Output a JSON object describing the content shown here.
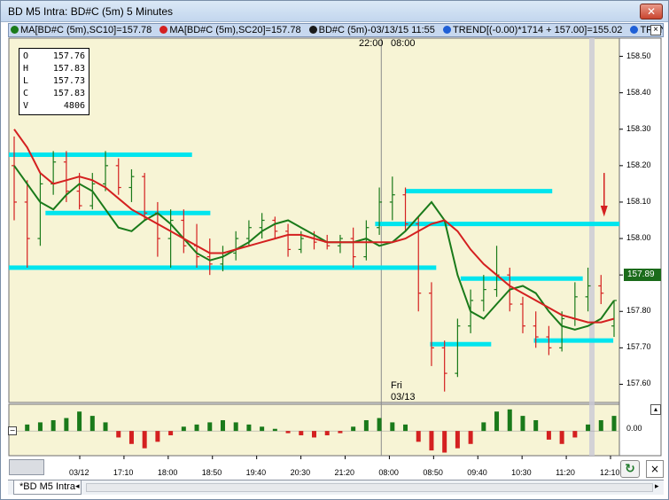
{
  "window": {
    "title": "BD M5 Intra: BD#C (5m) 5 Minutes",
    "close_glyph": "✕"
  },
  "legend": {
    "items": [
      {
        "label": "MA[BD#C (5m),SC10]=157.78",
        "color": "#1a7a1a"
      },
      {
        "label": "MA[BD#C (5m),SC20]=157.78",
        "color": "#d42020"
      },
      {
        "label": "BD#C (5m)-03/13/15 11:55",
        "color": "#1a1a1a"
      },
      {
        "label": "TREND[(-0.00)*1714 + 157.00]=155.02",
        "color": "#1f5fd6"
      },
      {
        "label": "TREN",
        "color": "#1f5fd6"
      }
    ],
    "close_glyph": "×"
  },
  "ohlc": {
    "rows": [
      {
        "k": "O",
        "v": "157.76"
      },
      {
        "k": "H",
        "v": "157.83"
      },
      {
        "k": "L",
        "v": "157.73"
      },
      {
        "k": "C",
        "v": "157.83"
      },
      {
        "k": "V",
        "v": "4806"
      }
    ]
  },
  "sessions": {
    "top_left": "22:00",
    "top_right": "08:00",
    "day_name": "Fri",
    "day_date": "03/13"
  },
  "price_axis": {
    "labels": [
      "158.50",
      "158.40",
      "158.30",
      "158.20",
      "158.10",
      "158.00",
      "157.90",
      "157.80",
      "157.70",
      "157.60"
    ],
    "current": "157.89"
  },
  "volume": {
    "zero_label": "0.00",
    "toggle_glyph": "−"
  },
  "time_axis": {
    "labels": [
      "03/12",
      "17:10",
      "18:00",
      "18:50",
      "19:40",
      "20:30",
      "21:20",
      "08:00",
      "08:50",
      "09:40",
      "10:30",
      "11:20",
      "12:10"
    ]
  },
  "controls": {
    "refresh_glyph": "↻",
    "collapse_glyph": "×",
    "collapse_top_glyph": "▴"
  },
  "tabs": [
    {
      "label": "*BD M5 Intra"
    }
  ],
  "colors": {
    "background": "#f7f4d5",
    "level_lines": "#00e5ee",
    "bar_up": "#1a7a1a",
    "bar_down": "#d42020",
    "ma_fast": "#1a7a1a",
    "ma_slow": "#d42020",
    "arrow": "#d42020"
  },
  "chart_data": {
    "type": "line",
    "ylim": [
      157.55,
      158.55
    ],
    "series": [
      {
        "name": "MA[BD#C (5m),SC10]",
        "values": [
          158.2,
          158.15,
          158.1,
          158.08,
          158.12,
          158.15,
          158.13,
          158.08,
          158.03,
          158.02,
          158.05,
          158.07,
          158.04,
          158.0,
          157.96,
          157.94,
          157.95,
          157.97,
          157.99,
          158.02,
          158.04,
          158.05,
          158.03,
          158.01,
          157.99,
          157.99,
          157.99,
          158.0,
          157.98,
          157.99,
          158.02,
          158.06,
          158.1,
          158.05,
          157.9,
          157.8,
          157.78,
          157.82,
          157.86,
          157.87,
          157.85,
          157.8,
          157.76,
          157.75,
          157.76,
          157.78,
          157.83
        ]
      },
      {
        "name": "MA[BD#C (5m),SC20]",
        "values": [
          158.3,
          158.25,
          158.18,
          158.15,
          158.16,
          158.17,
          158.16,
          158.14,
          158.11,
          158.08,
          158.06,
          158.04,
          158.02,
          158.0,
          157.98,
          157.96,
          157.96,
          157.97,
          157.98,
          157.99,
          158.0,
          158.01,
          158.01,
          158.0,
          157.99,
          157.99,
          157.99,
          157.99,
          157.99,
          157.99,
          158.0,
          158.02,
          158.04,
          158.05,
          158.02,
          157.97,
          157.93,
          157.9,
          157.87,
          157.85,
          157.83,
          157.81,
          157.79,
          157.78,
          157.77,
          157.77,
          157.78
        ]
      }
    ],
    "levels": [
      {
        "value": 158.23,
        "x_start": 0.0,
        "x_end": 0.3
      },
      {
        "value": 158.07,
        "x_start": 0.06,
        "x_end": 0.33
      },
      {
        "value": 157.92,
        "x_start": 0.0,
        "x_end": 0.7
      },
      {
        "value": 158.13,
        "x_start": 0.65,
        "x_end": 0.89
      },
      {
        "value": 158.04,
        "x_start": 0.6,
        "x_end": 1.0
      },
      {
        "value": 157.89,
        "x_start": 0.74,
        "x_end": 0.94
      },
      {
        "value": 157.72,
        "x_start": 0.86,
        "x_end": 0.99
      },
      {
        "value": 157.71,
        "x_start": 0.69,
        "x_end": 0.79
      }
    ],
    "price_bars": [
      {
        "o": 158.2,
        "h": 158.28,
        "l": 158.05,
        "c": 158.1
      },
      {
        "o": 158.1,
        "h": 158.16,
        "l": 157.92,
        "c": 158.0
      },
      {
        "o": 158.0,
        "h": 158.18,
        "l": 157.98,
        "c": 158.15
      },
      {
        "o": 158.15,
        "h": 158.24,
        "l": 158.12,
        "c": 158.21
      },
      {
        "o": 158.21,
        "h": 158.24,
        "l": 158.1,
        "c": 158.13
      },
      {
        "o": 158.13,
        "h": 158.18,
        "l": 158.08,
        "c": 158.09
      },
      {
        "o": 158.09,
        "h": 158.18,
        "l": 158.08,
        "c": 158.15
      },
      {
        "o": 158.15,
        "h": 158.24,
        "l": 158.13,
        "c": 158.2
      },
      {
        "o": 158.2,
        "h": 158.22,
        "l": 158.12,
        "c": 158.14
      },
      {
        "o": 158.14,
        "h": 158.19,
        "l": 158.1,
        "c": 158.17
      },
      {
        "o": 158.17,
        "h": 158.18,
        "l": 158.05,
        "c": 158.07
      },
      {
        "o": 158.07,
        "h": 158.1,
        "l": 157.95,
        "c": 158.0
      },
      {
        "o": 158.0,
        "h": 158.08,
        "l": 157.92,
        "c": 158.05
      },
      {
        "o": 158.05,
        "h": 158.08,
        "l": 157.96,
        "c": 157.98
      },
      {
        "o": 157.98,
        "h": 158.04,
        "l": 157.92,
        "c": 157.95
      },
      {
        "o": 157.95,
        "h": 158.0,
        "l": 157.9,
        "c": 157.93
      },
      {
        "o": 157.93,
        "h": 157.98,
        "l": 157.91,
        "c": 157.96
      },
      {
        "o": 157.96,
        "h": 158.02,
        "l": 157.94,
        "c": 158.0
      },
      {
        "o": 158.0,
        "h": 158.05,
        "l": 157.98,
        "c": 158.03
      },
      {
        "o": 158.03,
        "h": 158.07,
        "l": 158.0,
        "c": 158.05
      },
      {
        "o": 158.05,
        "h": 158.06,
        "l": 158.0,
        "c": 158.02
      },
      {
        "o": 158.02,
        "h": 158.04,
        "l": 157.95,
        "c": 157.97
      },
      {
        "o": 157.97,
        "h": 158.02,
        "l": 157.96,
        "c": 158.0
      },
      {
        "o": 158.0,
        "h": 158.02,
        "l": 157.97,
        "c": 157.99
      },
      {
        "o": 157.99,
        "h": 158.01,
        "l": 157.97,
        "c": 157.98
      },
      {
        "o": 157.98,
        "h": 158.01,
        "l": 157.96,
        "c": 158.0
      },
      {
        "o": 158.0,
        "h": 158.03,
        "l": 157.92,
        "c": 157.95
      },
      {
        "o": 157.95,
        "h": 158.05,
        "l": 157.94,
        "c": 158.03
      },
      {
        "o": 158.03,
        "h": 158.14,
        "l": 158.01,
        "c": 158.1
      },
      {
        "o": 158.1,
        "h": 158.17,
        "l": 158.05,
        "c": 158.12
      },
      {
        "o": 158.12,
        "h": 158.14,
        "l": 158.02,
        "c": 158.04
      },
      {
        "o": 158.04,
        "h": 158.06,
        "l": 157.8,
        "c": 157.85
      },
      {
        "o": 157.85,
        "h": 157.88,
        "l": 157.65,
        "c": 157.7
      },
      {
        "o": 157.7,
        "h": 157.72,
        "l": 157.58,
        "c": 157.63
      },
      {
        "o": 157.63,
        "h": 157.78,
        "l": 157.62,
        "c": 157.76
      },
      {
        "o": 157.76,
        "h": 157.86,
        "l": 157.74,
        "c": 157.83
      },
      {
        "o": 157.83,
        "h": 157.9,
        "l": 157.8,
        "c": 157.86
      },
      {
        "o": 157.86,
        "h": 157.98,
        "l": 157.84,
        "c": 157.9
      },
      {
        "o": 157.9,
        "h": 157.92,
        "l": 157.8,
        "c": 157.82
      },
      {
        "o": 157.82,
        "h": 157.84,
        "l": 157.74,
        "c": 157.76
      },
      {
        "o": 157.76,
        "h": 157.8,
        "l": 157.7,
        "c": 157.73
      },
      {
        "o": 157.73,
        "h": 157.76,
        "l": 157.68,
        "c": 157.7
      },
      {
        "o": 157.7,
        "h": 157.8,
        "l": 157.69,
        "c": 157.78
      },
      {
        "o": 157.78,
        "h": 157.88,
        "l": 157.76,
        "c": 157.84
      },
      {
        "o": 157.84,
        "h": 157.92,
        "l": 157.8,
        "c": 157.87
      },
      {
        "o": 157.87,
        "h": 157.9,
        "l": 157.82,
        "c": 157.85
      },
      {
        "o": 157.76,
        "h": 157.83,
        "l": 157.73,
        "c": 157.83
      }
    ],
    "volume_bars": [
      0.2,
      0.3,
      0.4,
      0.5,
      0.6,
      0.9,
      0.7,
      0.4,
      -0.3,
      -0.6,
      -0.8,
      -0.5,
      -0.2,
      0.2,
      0.3,
      0.4,
      0.5,
      0.4,
      0.3,
      0.2,
      0.1,
      -0.1,
      -0.2,
      -0.3,
      -0.2,
      -0.1,
      0.2,
      0.5,
      0.6,
      0.4,
      0.3,
      -0.5,
      -0.9,
      -1.0,
      -0.8,
      -0.6,
      0.4,
      0.9,
      1.0,
      0.7,
      0.5,
      -0.4,
      -0.6,
      -0.3,
      0.3,
      0.5,
      0.7
    ]
  }
}
